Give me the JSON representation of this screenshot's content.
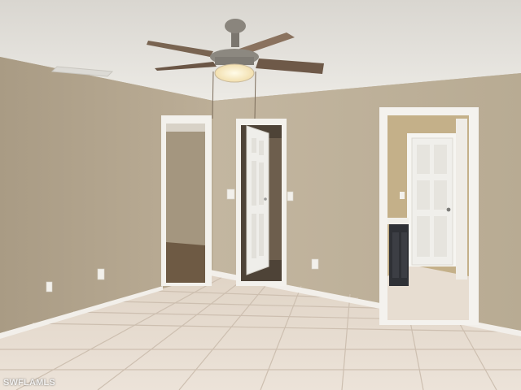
{
  "watermark": {
    "text": "SWFLAMLS"
  },
  "palette": {
    "ceiling": "#e9e7e2",
    "wall_left": "#b3a68f",
    "wall_back": "#c0b39c",
    "floor_tile": "#e8ddd2",
    "grout": "#cfc3b6",
    "trim": "#f4f2ee",
    "door": "#efeeea",
    "fan_blade": "#7a6552"
  },
  "scene": {
    "ceiling_fan": "ceiling-fan-with-light",
    "doorways": [
      "closet-doorway",
      "closet-door-open",
      "bathroom-doorway"
    ],
    "floor": "ceramic-tile"
  }
}
